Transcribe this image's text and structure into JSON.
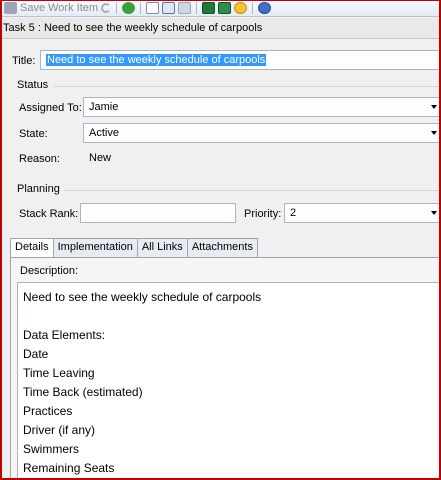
{
  "toolbar": {
    "save_label": "Save Work Item",
    "icons": [
      "save-icon",
      "undo-icon",
      "refresh-icon",
      "new-doc-icon",
      "copy-icon",
      "cut-icon",
      "excel-icon",
      "excel-export-icon",
      "smiley-icon",
      "globe-icon"
    ]
  },
  "window": {
    "title": "Task 5 : Need to see the weekly schedule of carpools"
  },
  "form": {
    "title_label": "Title:",
    "title_value": "Need to see the weekly schedule of carpools",
    "status": {
      "heading": "Status",
      "assigned_label": "Assigned To:",
      "assigned_value": "Jamie",
      "state_label": "State:",
      "state_value": "Active",
      "reason_label": "Reason:",
      "reason_value": "New"
    },
    "planning": {
      "heading": "Planning",
      "stack_rank_label": "Stack Rank:",
      "stack_rank_value": "",
      "priority_label": "Priority:",
      "priority_value": "2"
    }
  },
  "tabs": [
    {
      "label": "Details",
      "active": true
    },
    {
      "label": "Implementation",
      "active": false
    },
    {
      "label": "All Links",
      "active": false
    },
    {
      "label": "Attachments",
      "active": false
    }
  ],
  "details": {
    "description_label": "Description:",
    "lines": [
      "Need to see the weekly schedule of carpools",
      "",
      "Data Elements:",
      "Date",
      "Time Leaving",
      "Time Back (estimated)",
      "Practices",
      "Driver (if any)",
      "Swimmers",
      "Remaining Seats"
    ]
  },
  "colors": {
    "selection": "#3399ff",
    "frame": "#c00000"
  }
}
